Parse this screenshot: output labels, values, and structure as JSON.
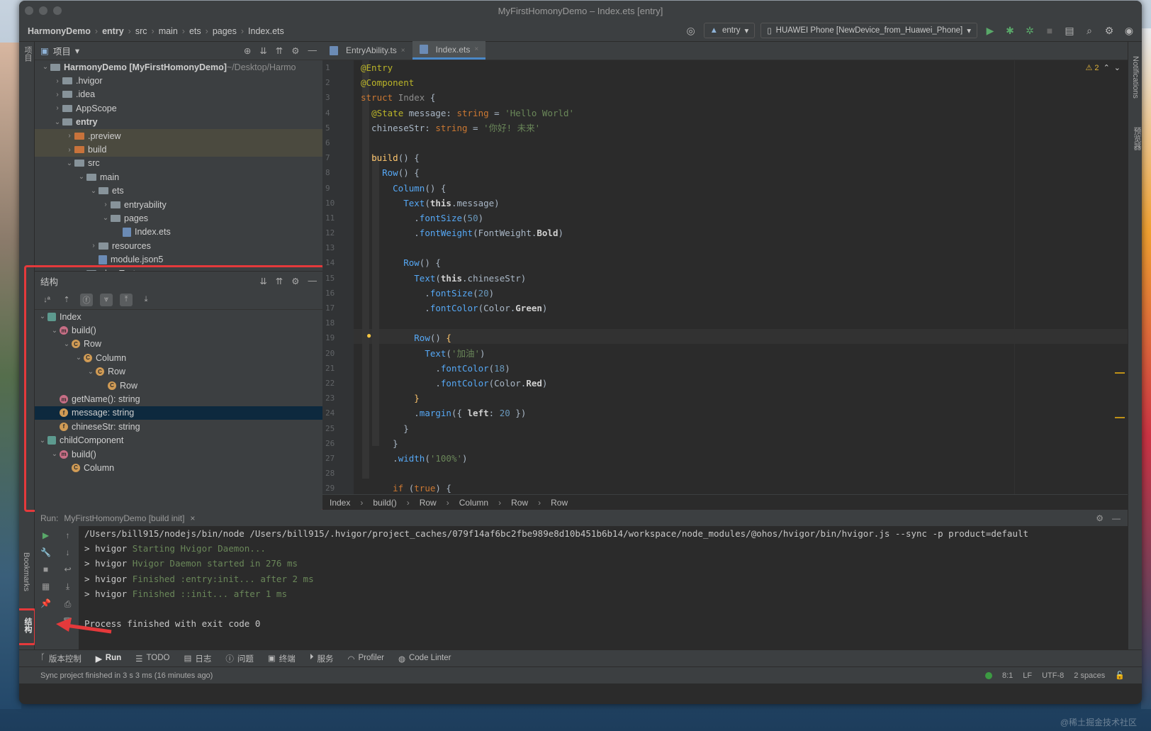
{
  "window": {
    "title": "MyFirstHomonyDemo – Index.ets [entry]"
  },
  "navbar": {
    "crumbs": [
      "HarmonyDemo",
      "entry",
      "src",
      "main",
      "ets",
      "pages",
      "Index.ets"
    ],
    "module_select": "entry",
    "device_select": "HUAWEI Phone [NewDevice_from_Huawei_Phone]"
  },
  "left_strip": {
    "project_tab": "项目",
    "bookmarks_tab": "Bookmarks",
    "structure_tab": "结构"
  },
  "right_strip": {
    "notifications_tab": "Notifications",
    "previewer_tab": "预览器"
  },
  "project": {
    "header": "项目",
    "items": [
      {
        "indent": 0,
        "chev": "⌄",
        "icon": "module",
        "label": "HarmonyDemo [MyFirstHomonyDemo]",
        "extra": " ~/Desktop/Harmo"
      },
      {
        "indent": 1,
        "chev": "›",
        "icon": "folder",
        "label": ".hvigor"
      },
      {
        "indent": 1,
        "chev": "›",
        "icon": "folder",
        "label": ".idea"
      },
      {
        "indent": 1,
        "chev": "›",
        "icon": "folder",
        "label": "AppScope"
      },
      {
        "indent": 1,
        "chev": "⌄",
        "icon": "module",
        "label": "entry",
        "bold": true
      },
      {
        "indent": 2,
        "chev": "›",
        "icon": "folder-o",
        "label": ".preview",
        "hl": true
      },
      {
        "indent": 2,
        "chev": "›",
        "icon": "folder-o",
        "label": "build",
        "hl": true
      },
      {
        "indent": 2,
        "chev": "⌄",
        "icon": "folder",
        "label": "src"
      },
      {
        "indent": 3,
        "chev": "⌄",
        "icon": "folder",
        "label": "main"
      },
      {
        "indent": 4,
        "chev": "⌄",
        "icon": "folder",
        "label": "ets"
      },
      {
        "indent": 5,
        "chev": "›",
        "icon": "folder",
        "label": "entryability"
      },
      {
        "indent": 5,
        "chev": "⌄",
        "icon": "folder",
        "label": "pages"
      },
      {
        "indent": 6,
        "chev": "",
        "icon": "file",
        "label": "Index.ets"
      },
      {
        "indent": 4,
        "chev": "›",
        "icon": "folder",
        "label": "resources"
      },
      {
        "indent": 4,
        "chev": "",
        "icon": "file",
        "label": "module.json5"
      },
      {
        "indent": 3,
        "chev": "›",
        "icon": "folder",
        "label": "ohosTest"
      }
    ]
  },
  "structure": {
    "header": "结构",
    "items": [
      {
        "indent": 0,
        "chev": "⌄",
        "badge": "s",
        "label": "Index"
      },
      {
        "indent": 1,
        "chev": "⌄",
        "badge": "m",
        "label": "build()"
      },
      {
        "indent": 2,
        "chev": "⌄",
        "badge": "c",
        "label": "Row"
      },
      {
        "indent": 3,
        "chev": "⌄",
        "badge": "c",
        "label": "Column"
      },
      {
        "indent": 4,
        "chev": "⌄",
        "badge": "c",
        "label": "Row"
      },
      {
        "indent": 5,
        "chev": "",
        "badge": "c",
        "label": "Row"
      },
      {
        "indent": 1,
        "chev": "",
        "badge": "m",
        "label": "getName(): string"
      },
      {
        "indent": 1,
        "chev": "",
        "badge": "f",
        "label": "message: string",
        "sel": true
      },
      {
        "indent": 1,
        "chev": "",
        "badge": "f",
        "label": "chineseStr: string"
      },
      {
        "indent": 0,
        "chev": "⌄",
        "badge": "s",
        "label": "childComponent"
      },
      {
        "indent": 1,
        "chev": "⌄",
        "badge": "m",
        "label": "build()"
      },
      {
        "indent": 2,
        "chev": "",
        "badge": "c",
        "label": "Column"
      }
    ]
  },
  "editor": {
    "tabs": [
      {
        "label": "EntryAbility.ts",
        "active": false
      },
      {
        "label": "Index.ets",
        "active": true
      }
    ],
    "warnings": "⚠ 2",
    "lines": [
      [
        [
          "a",
          "@Entry"
        ]
      ],
      [
        [
          "a",
          "@Component"
        ]
      ],
      [
        [
          "k",
          "struct "
        ],
        [
          "g",
          "Index "
        ],
        [
          "x",
          "{"
        ]
      ],
      [
        [
          "x",
          "  "
        ],
        [
          "a",
          "@State "
        ],
        [
          "x",
          "message: "
        ],
        [
          "k",
          "string "
        ],
        [
          "x",
          "= "
        ],
        [
          "s",
          "'Hello World'"
        ]
      ],
      [
        [
          "x",
          "  chineseStr: "
        ],
        [
          "k",
          "string "
        ],
        [
          "x",
          "= "
        ],
        [
          "s",
          "'你好! 未来'"
        ]
      ],
      [
        [
          "x",
          ""
        ]
      ],
      [
        [
          "x",
          "  "
        ],
        [
          "t",
          "build"
        ],
        [
          "x",
          "() {"
        ]
      ],
      [
        [
          "x",
          "    "
        ],
        [
          "f",
          "Row"
        ],
        [
          "x",
          "() {"
        ]
      ],
      [
        [
          "x",
          "      "
        ],
        [
          "f",
          "Column"
        ],
        [
          "x",
          "() {"
        ]
      ],
      [
        [
          "x",
          "        "
        ],
        [
          "f",
          "Text"
        ],
        [
          "x",
          "("
        ],
        [
          "w",
          "this"
        ],
        [
          "x",
          ".message)"
        ]
      ],
      [
        [
          "x",
          "          ."
        ],
        [
          "f",
          "fontSize"
        ],
        [
          "x",
          "("
        ],
        [
          "n",
          "50"
        ],
        [
          "x",
          ")"
        ]
      ],
      [
        [
          "x",
          "          ."
        ],
        [
          "f",
          "fontWeight"
        ],
        [
          "x",
          "(FontWeight."
        ],
        [
          "w",
          "Bold"
        ],
        [
          "x",
          ")"
        ]
      ],
      [
        [
          "x",
          ""
        ]
      ],
      [
        [
          "x",
          "        "
        ],
        [
          "f",
          "Row"
        ],
        [
          "x",
          "() {"
        ]
      ],
      [
        [
          "x",
          "          "
        ],
        [
          "f",
          "Text"
        ],
        [
          "x",
          "("
        ],
        [
          "w",
          "this"
        ],
        [
          "x",
          ".chineseStr)"
        ]
      ],
      [
        [
          "x",
          "            ."
        ],
        [
          "f",
          "fontSize"
        ],
        [
          "x",
          "("
        ],
        [
          "n",
          "20"
        ],
        [
          "x",
          ")"
        ]
      ],
      [
        [
          "x",
          "            ."
        ],
        [
          "f",
          "fontColor"
        ],
        [
          "x",
          "(Color."
        ],
        [
          "w",
          "Green"
        ],
        [
          "x",
          ")"
        ]
      ],
      [
        [
          "x",
          ""
        ]
      ],
      [
        [
          "x",
          "          "
        ],
        [
          "f",
          "Row"
        ],
        [
          "x",
          "() "
        ],
        [
          "t",
          "{"
        ]
      ],
      [
        [
          "x",
          "            "
        ],
        [
          "f",
          "Text"
        ],
        [
          "x",
          "("
        ],
        [
          "s",
          "'加油'"
        ],
        [
          "x",
          ")"
        ]
      ],
      [
        [
          "x",
          "              ."
        ],
        [
          "f",
          "fontColor"
        ],
        [
          "x",
          "("
        ],
        [
          "n",
          "18"
        ],
        [
          "x",
          ")"
        ]
      ],
      [
        [
          "x",
          "              ."
        ],
        [
          "f",
          "fontColor"
        ],
        [
          "x",
          "(Color."
        ],
        [
          "w",
          "Red"
        ],
        [
          "x",
          ")"
        ]
      ],
      [
        [
          "x",
          "          "
        ],
        [
          "t",
          "}"
        ]
      ],
      [
        [
          "x",
          "          ."
        ],
        [
          "f",
          "margin"
        ],
        [
          "x",
          "({ "
        ],
        [
          "w",
          "left"
        ],
        [
          "x",
          ": "
        ],
        [
          "n",
          "20"
        ],
        [
          "x",
          " })"
        ]
      ],
      [
        [
          "x",
          "        }"
        ]
      ],
      [
        [
          "x",
          "      }"
        ]
      ],
      [
        [
          "x",
          "      ."
        ],
        [
          "f",
          "width"
        ],
        [
          "x",
          "("
        ],
        [
          "s",
          "'100%'"
        ],
        [
          "x",
          ")"
        ]
      ],
      [
        [
          "x",
          ""
        ]
      ],
      [
        [
          "x",
          "      "
        ],
        [
          "k",
          "if "
        ],
        [
          "x",
          "("
        ],
        [
          "k",
          "true"
        ],
        [
          "x",
          ") {"
        ]
      ]
    ],
    "line_numbers": [
      "1",
      "2",
      "3",
      "4",
      "5",
      "6",
      "7",
      "8",
      "9",
      "10",
      "11",
      "12",
      "13",
      "14",
      "15",
      "16",
      "17",
      "18",
      "19",
      "20",
      "21",
      "22",
      "23",
      "24",
      "25",
      "26",
      "27",
      "28",
      "29"
    ],
    "breadcrumb": [
      "Index",
      "build()",
      "Row",
      "Column",
      "Row",
      "Row"
    ]
  },
  "run": {
    "label": "Run:",
    "config": "MyFirstHomonyDemo [build init]",
    "lines": [
      [
        [
          "x",
          "/Users/bill915/nodejs/bin/node /Users/bill915/.hvigor/project_caches/079f14af6bc2fbe989e8d10b451b6b14/workspace/node_modules/@ohos/hvigor/bin/hvigor.js --sync -p product=default"
        ]
      ],
      [
        [
          "x",
          "> hvigor "
        ],
        [
          "g",
          "Starting Hvigor Daemon..."
        ]
      ],
      [
        [
          "x",
          "> hvigor "
        ],
        [
          "g",
          "Hvigor Daemon started in 276 ms"
        ]
      ],
      [
        [
          "x",
          "> hvigor "
        ],
        [
          "g",
          "Finished :entry:init... after 2 ms"
        ]
      ],
      [
        [
          "x",
          "> hvigor "
        ],
        [
          "g",
          "Finished ::init... after 1 ms"
        ]
      ],
      [
        [
          "x",
          ""
        ]
      ],
      [
        [
          "x",
          "Process finished with exit code 0"
        ]
      ]
    ]
  },
  "bottom_tabs": [
    "版本控制",
    "Run",
    "TODO",
    "日志",
    "问题",
    "终端",
    "服务",
    "Profiler",
    "Code Linter"
  ],
  "status": {
    "message": "Sync project finished in 3 s 3 ms (16 minutes ago)",
    "position": "8:1",
    "line_sep": "LF",
    "encoding": "UTF-8",
    "indent": "2 spaces"
  },
  "watermark": "@稀土掘金技术社区",
  "colors": {
    "accent": "#4a88c7",
    "highlight_box": "#e5393b",
    "run_green": "#59a869"
  }
}
